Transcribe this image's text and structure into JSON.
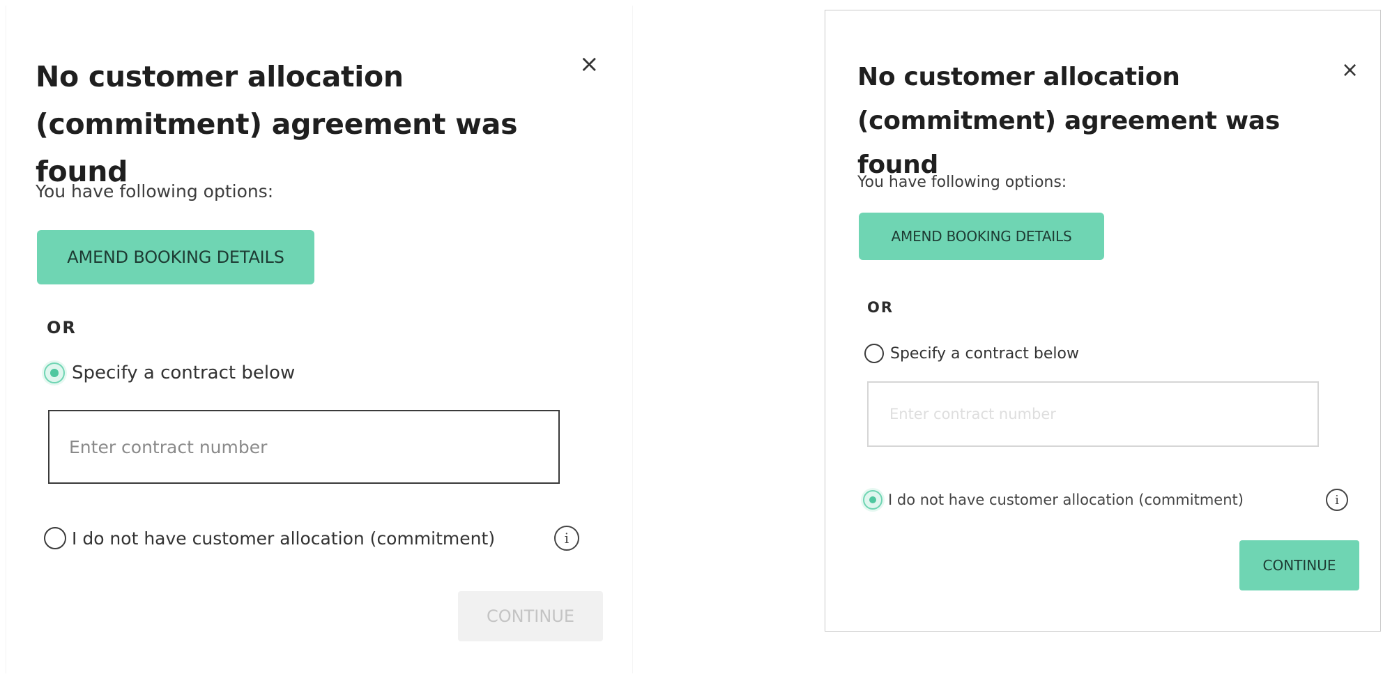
{
  "dialogs": [
    {
      "title": "No customer allocation (commitment) agreement was found",
      "close_symbol": "×",
      "intro": "You have following options:",
      "amend_label": "AMEND BOOKING DETAILS",
      "or_label": "OR",
      "option_specify_label": "Specify a contract below",
      "option_specify_selected": true,
      "input_placeholder": "Enter contract number",
      "input_value": "",
      "option_none_label": "I do not have customer allocation (commitment)",
      "option_none_selected": false,
      "info_symbol": "i",
      "continue_label": "CONTINUE",
      "continue_enabled": false
    },
    {
      "title": "No customer allocation (commitment) agreement was found",
      "close_symbol": "×",
      "intro": "You have following options:",
      "amend_label": "AMEND BOOKING DETAILS",
      "or_label": "OR",
      "option_specify_label": "Specify a contract below",
      "option_specify_selected": false,
      "input_placeholder": "Enter contract number",
      "input_value": "",
      "option_none_label": "I do not have customer allocation (commitment)",
      "option_none_selected": true,
      "info_symbol": "i",
      "continue_label": "CONTINUE",
      "continue_enabled": true
    }
  ],
  "colors": {
    "accent": "#6fd5b3",
    "disabled_button": "#f1f1f1",
    "disabled_text": "#c4c4c4"
  },
  "icons": {
    "close": "close-icon",
    "info": "info-icon",
    "radio": "radio-icon"
  }
}
